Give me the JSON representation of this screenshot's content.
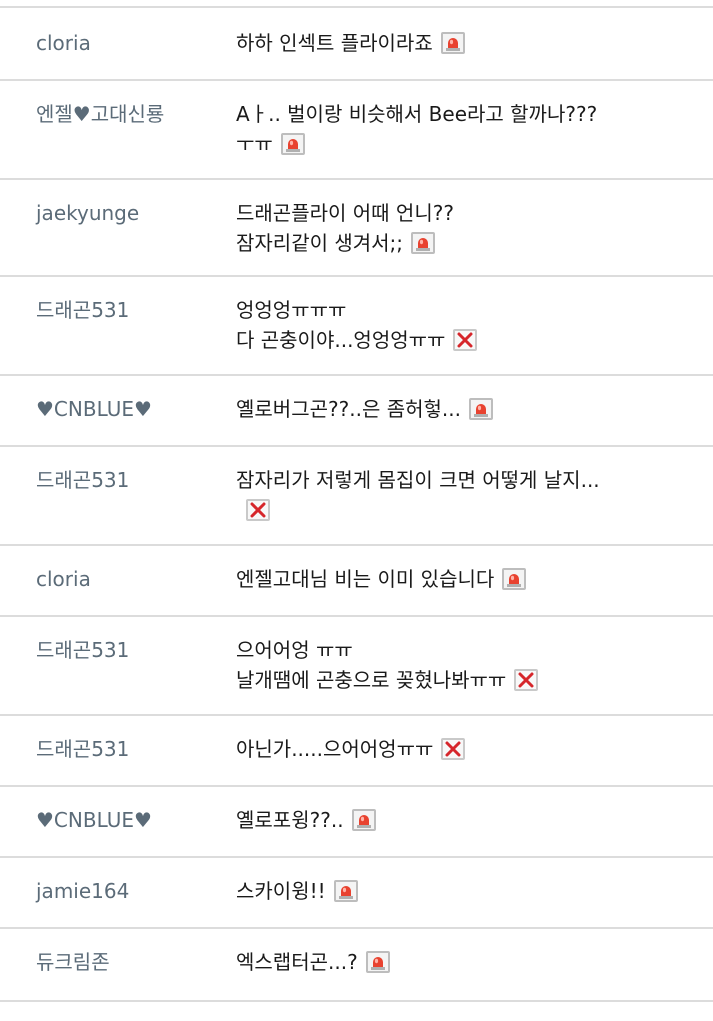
{
  "comments": [
    {
      "author": "cloria",
      "lines": [
        "하하 인섹트 플라이라죠"
      ],
      "icon": "siren-icon"
    },
    {
      "author": "엔젤♥고대신룡",
      "lines": [
        "Aㅏ.. 벌이랑 비슷해서 Bee라고 할까나???",
        "ㅜㅠ"
      ],
      "icon": "siren-icon"
    },
    {
      "author": "jaekyunge",
      "lines": [
        "드래곤플라이 어때 언니??",
        "잠자리같이 생겨서;;"
      ],
      "icon": "siren-icon"
    },
    {
      "author": "드래곤531",
      "lines": [
        "엉엉엉ㅠㅠㅠ",
        "다 곤충이야...엉엉엉ㅠㅠ"
      ],
      "icon": "delete-icon"
    },
    {
      "author": "♥CNBLUE♥",
      "lines": [
        "옐로버그곤??..은 좀허헣..."
      ],
      "icon": "siren-icon"
    },
    {
      "author": "드래곤531",
      "lines": [
        "잠자리가 저렇게 몸집이 크면 어떻게 날지...",
        ""
      ],
      "icon": "delete-icon"
    },
    {
      "author": "cloria",
      "lines": [
        "엔젤고대님 비는 이미 있습니다"
      ],
      "icon": "siren-icon"
    },
    {
      "author": "드래곤531",
      "lines": [
        "으어어엉 ㅠㅠ",
        "날개땜에 곤충으로 꽂혔나봐ㅠㅠ"
      ],
      "icon": "delete-icon"
    },
    {
      "author": "드래곤531",
      "lines": [
        "아닌가.....으어어엉ㅠㅠ"
      ],
      "icon": "delete-icon"
    },
    {
      "author": "♥CNBLUE♥",
      "lines": [
        "옐로포윙??.."
      ],
      "icon": "siren-icon"
    },
    {
      "author": "jamie164",
      "lines": [
        "스카이윙!!"
      ],
      "icon": "siren-icon"
    },
    {
      "author": "듀크림존",
      "lines": [
        "엑스랩터곤...?"
      ],
      "icon": "siren-icon"
    }
  ]
}
